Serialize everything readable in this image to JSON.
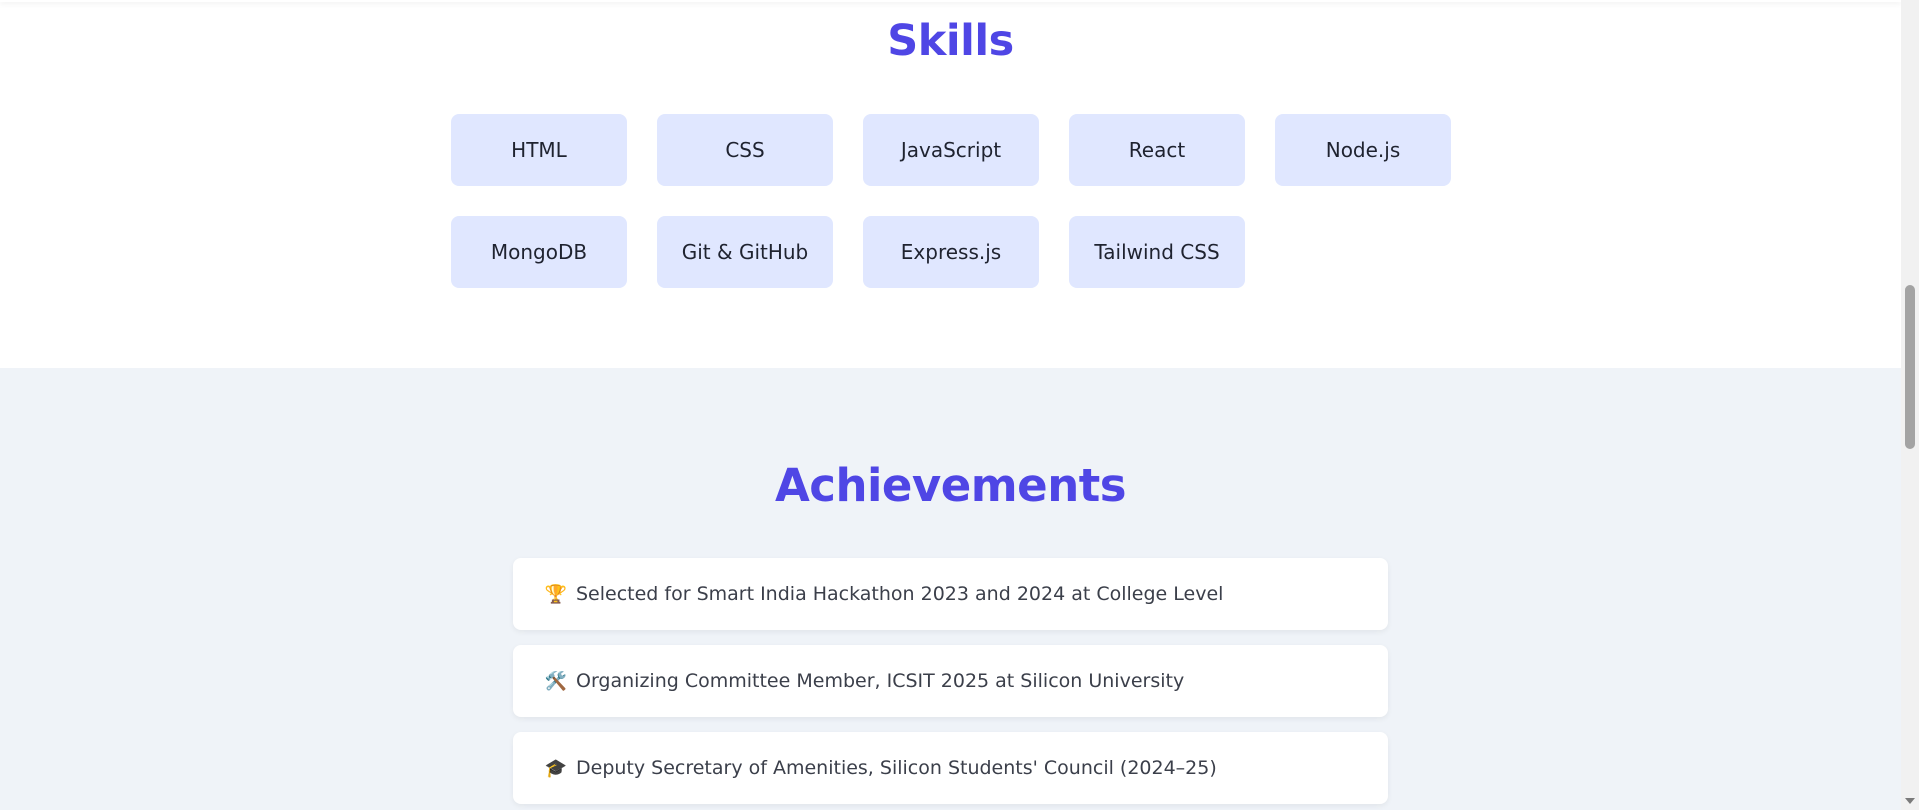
{
  "skills": {
    "title": "Skills",
    "items": [
      {
        "label": "HTML"
      },
      {
        "label": "CSS"
      },
      {
        "label": "JavaScript"
      },
      {
        "label": "React"
      },
      {
        "label": "Node.js"
      },
      {
        "label": "MongoDB"
      },
      {
        "label": "Git & GitHub"
      },
      {
        "label": "Express.js"
      },
      {
        "label": "Tailwind CSS"
      }
    ]
  },
  "achievements": {
    "title": "Achievements",
    "items": [
      {
        "icon": "🏆",
        "icon_name": "trophy-icon",
        "text": "Selected for Smart India Hackathon 2023 and 2024 at College Level"
      },
      {
        "icon": "🛠️",
        "icon_name": "tools-icon",
        "text": "Organizing Committee Member, ICSIT 2025 at Silicon University"
      },
      {
        "icon": "🎓",
        "icon_name": "graduation-cap-icon",
        "text": "Deputy Secretary of Amenities, Silicon Students' Council (2024–25)"
      }
    ]
  },
  "colors": {
    "accent": "#4f46e5",
    "skill_card_bg": "#e0e7ff",
    "achievements_bg": "#eff3f8"
  }
}
